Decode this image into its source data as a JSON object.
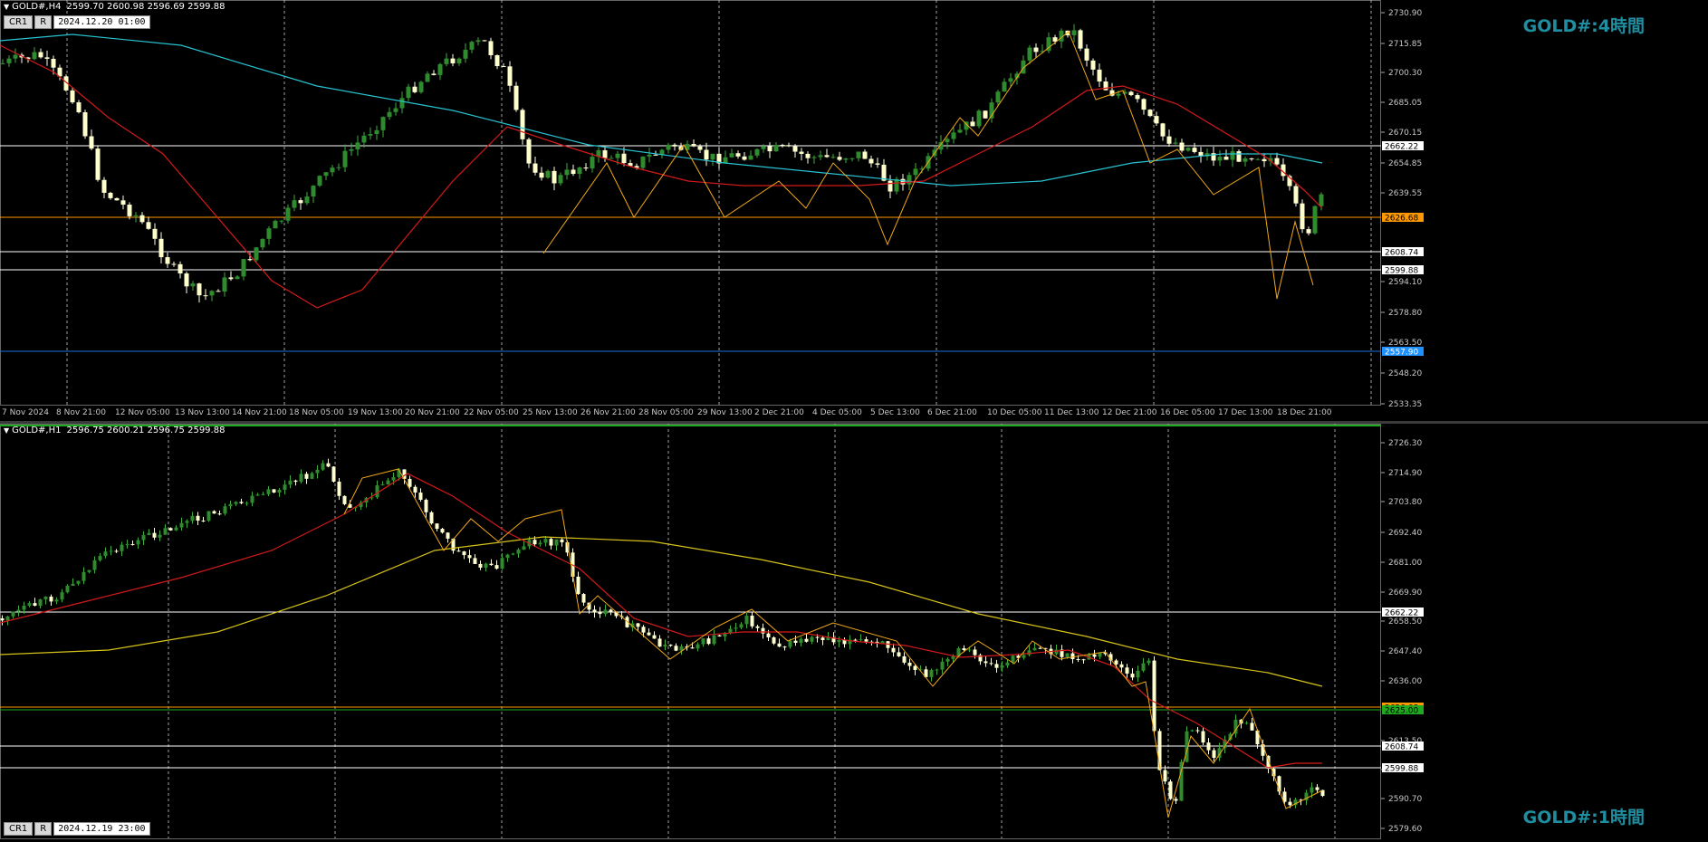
{
  "top": {
    "symbol": "GOLD#,H4",
    "ohlc": "2599.70 2600.98 2596.69 2599.88",
    "btn_cr": "CR1",
    "btn_r": "R",
    "datetime": "2024.12.20 01:00",
    "watermark": "GOLD#:4時間",
    "price_labels": [
      "2730.90",
      "2715.85",
      "2700.30",
      "2685.05",
      "2670.15",
      "2654.85",
      "2639.55",
      "2594.10",
      "2578.80",
      "2563.50",
      "2548.20",
      "2533.35"
    ],
    "time_labels": [
      "7 Nov 2024",
      "8 Nov 21:00",
      "12 Nov 05:00",
      "13 Nov 13:00",
      "14 Nov 21:00",
      "18 Nov 05:00",
      "19 Nov 13:00",
      "20 Nov 21:00",
      "22 Nov 05:00",
      "25 Nov 13:00",
      "26 Nov 21:00",
      "28 Nov 05:00",
      "29 Nov 13:00",
      "2 Dec 21:00",
      "4 Dec 05:00",
      "5 Dec 13:00",
      "6 Dec 21:00",
      "10 Dec 05:00",
      "11 Dec 13:00",
      "12 Dec 21:00",
      "16 Dec 05:00",
      "17 Dec 13:00",
      "18 Dec 21:00"
    ],
    "levels": [
      {
        "price": "2662.22",
        "color": "#ffffff",
        "tag_bg": "#ffffff",
        "tag_fg": "#000000"
      },
      {
        "price": "2626.68",
        "color": "#ff9900",
        "tag_bg": "#ff9900",
        "tag_fg": "#000000"
      },
      {
        "price": "2608.74",
        "color": "#ffffff",
        "tag_bg": "#ffffff",
        "tag_fg": "#000000"
      },
      {
        "price": "2599.88",
        "color": "#ffffff",
        "tag_bg": "#ffffff",
        "tag_fg": "#000000"
      },
      {
        "price": "2557.90",
        "color": "#1e6fd8",
        "tag_bg": "#1e90ff",
        "tag_fg": "#ffffff"
      }
    ]
  },
  "bottom": {
    "symbol": "GOLD#,H1",
    "ohlc": "2596.75 2600.21 2596.75 2599.88",
    "btn_cr": "CR1",
    "btn_r": "R",
    "datetime": "2024.12.19 23:00",
    "watermark": "GOLD#:1時間",
    "price_labels": [
      "2726.30",
      "2714.90",
      "2703.80",
      "2692.40",
      "2681.00",
      "2669.90",
      "2658.50",
      "2647.40",
      "2636.00",
      "2613.50",
      "2602.10",
      "2590.70",
      "2579.60"
    ],
    "levels": [
      {
        "price": "2662.22",
        "color": "#ffffff",
        "tag_bg": "#ffffff",
        "tag_fg": "#000000"
      },
      {
        "price": "2626.68",
        "color": "#ff9900",
        "tag_bg": "#ff9900",
        "tag_fg": "#000000"
      },
      {
        "price": "2625.00",
        "color": "#1faa1f",
        "tag_bg": "#1faa1f",
        "tag_fg": "#000000"
      },
      {
        "price": "2608.74",
        "color": "#ffffff",
        "tag_bg": "#ffffff",
        "tag_fg": "#000000"
      },
      {
        "price": "2599.88",
        "color": "#ffffff",
        "tag_bg": "#ffffff",
        "tag_fg": "#000000"
      }
    ]
  },
  "colors": {
    "bull": "#2e8b2e",
    "bear": "#ffffcc",
    "ma_red": "#d41a1a",
    "ma_cyan": "#28c2d0",
    "ma_yellow": "#d6c21a",
    "zigzag": "#f0a818",
    "grid": "#c8c8c8",
    "watermark": "#1f8ea0"
  }
}
